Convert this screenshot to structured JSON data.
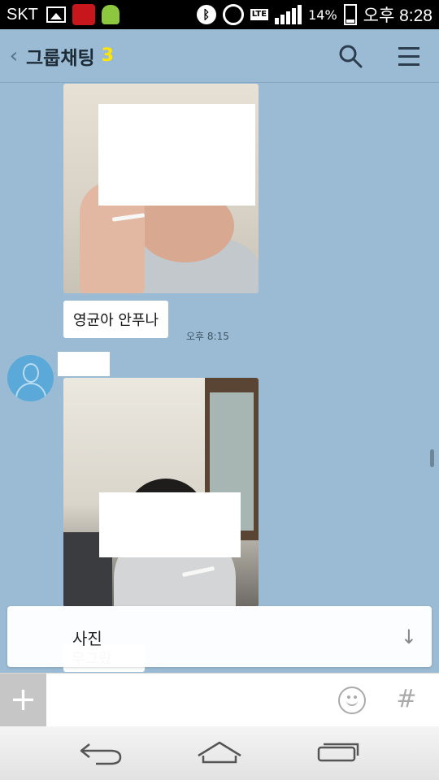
{
  "status_bar": {
    "carrier": "SKT",
    "lte_label": "LTE",
    "battery_percent": "14%",
    "battery_level": 0.14,
    "time": "오후 8:28"
  },
  "header": {
    "title": "그룹채팅",
    "member_count": "3"
  },
  "messages": [
    {
      "type": "photo",
      "sender": "me"
    },
    {
      "type": "text",
      "text": "영균아 안푸나",
      "time": "오후 8:15"
    },
    {
      "type": "photo",
      "sender": "other"
    },
    {
      "type": "text-partial",
      "text": "무그랐"
    }
  ],
  "new_message_banner": {
    "label": "사진"
  },
  "input": {
    "value": "",
    "placeholder": ""
  },
  "icons": {
    "back": "chevron-left-icon",
    "search": "search-icon",
    "menu": "hamburger-menu-icon",
    "attach": "plus-icon",
    "emoticon": "smiley-icon",
    "hashtag": "hash-icon",
    "nav_back": "back-arrow-icon",
    "nav_home": "home-icon",
    "nav_recent": "recent-apps-icon"
  },
  "colors": {
    "chat_background": "#9bbbd4",
    "member_count": "#ffe600",
    "bubble": "#ffffff"
  }
}
